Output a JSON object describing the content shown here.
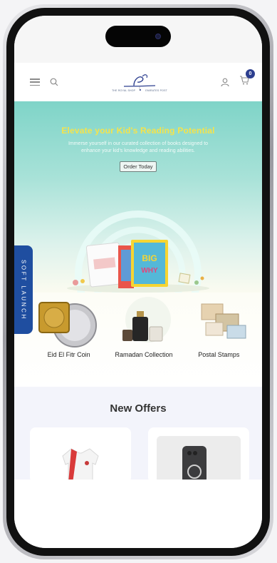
{
  "nav": {
    "logo_sub_left": "THE ROYAL SHOP",
    "logo_sub_right": "EMIRATES POST",
    "cart_count": "0"
  },
  "hero": {
    "title": "Elevate your Kid's Reading Potential",
    "subtitle": "Immerse yourself in our curated collection of books designed to enhance your kid's knowledge and reading abilities.",
    "cta": "Order Today",
    "book_text_big": "BIG",
    "book_text_why": "WHY"
  },
  "side_tab": {
    "label": "SOFT LAUNCH"
  },
  "categories": [
    {
      "label": "Eid El Fitr Coin"
    },
    {
      "label": "Ramadan Collection"
    },
    {
      "label": "Postal Stamps"
    }
  ],
  "offers": {
    "title": "New Offers"
  },
  "icons": [
    "menu-icon",
    "search-icon",
    "user-icon",
    "cart-icon"
  ],
  "colors": {
    "accent": "#2d3f8f",
    "hero_title": "#f5e34b",
    "soft_launch": "#1f4ea0"
  }
}
